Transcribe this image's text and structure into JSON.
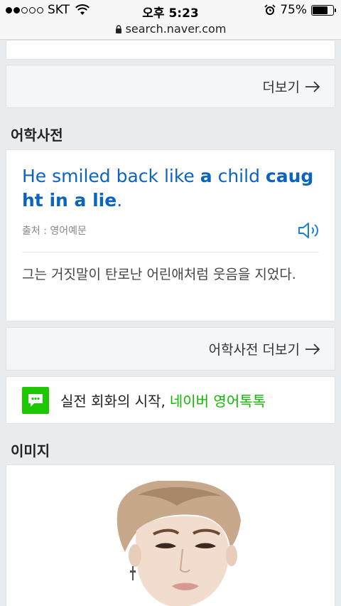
{
  "status_bar": {
    "carrier": "SKT",
    "time": "오후 5:23",
    "battery": "75%",
    "battery_level": 0.75
  },
  "url_bar": {
    "domain": "search.naver.com"
  },
  "first_more": {
    "label": "더보기"
  },
  "dictionary": {
    "section_title": "어학사전",
    "sentence_parts": [
      {
        "text": "He smiled back like ",
        "bold": false
      },
      {
        "text": "a",
        "bold": true
      },
      {
        "text": " child ",
        "bold": false
      },
      {
        "text": "caught in a lie",
        "bold": true
      },
      {
        "text": ".",
        "bold": false
      }
    ],
    "source": "출처 : 영어예문",
    "meaning": "그는 거짓말이 탄로난 어린애처럼 웃음을 지었다.",
    "more_label": "어학사전 더보기"
  },
  "talk_banner": {
    "text": "실전 회화의 시작,",
    "link_text": "네이버 영어톡톡"
  },
  "images": {
    "section_title": "이미지"
  },
  "icons": {
    "speaker": "speaker-icon",
    "arrow": "arrow-right-icon",
    "talk": "chat-bubble-icon",
    "lock": "lock-icon"
  },
  "colors": {
    "link_blue": "#0b64c0",
    "naver_green": "#1ec800",
    "talk_green": "#11b800"
  }
}
